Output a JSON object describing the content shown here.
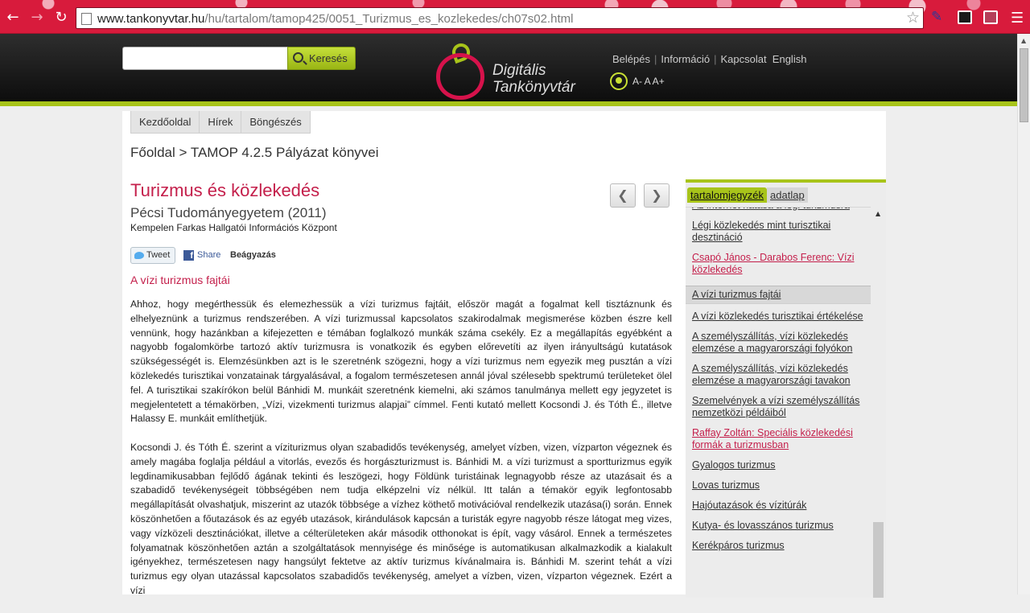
{
  "browser": {
    "url_host": "www.tankonyvtar.hu",
    "url_path": "/hu/tartalom/tamop425/0051_Turizmus_es_kozlekedes/ch07s02.html"
  },
  "header": {
    "search_button": "Keresés",
    "logo_line1": "Digitális",
    "logo_line2": "Tankönyvtár",
    "links": [
      "Belépés",
      "Információ",
      "Kapcsolat",
      "English"
    ],
    "font_sizes": "A- A A+"
  },
  "nav_tabs": [
    "Kezdőoldal",
    "Hírek",
    "Böngészés"
  ],
  "breadcrumb": "Főoldal > TAMOP 4.2.5 Pályázat könyvei",
  "book": {
    "title": "Turizmus és közlekedés",
    "subtitle": "Pécsi Tudományegyetem (2011)",
    "publisher": "Kempelen Farkas Hallgatói Információs Központ"
  },
  "social": {
    "tweet": "Tweet",
    "share": "Share",
    "embed": "Beágyazás"
  },
  "section_title": "A vízi turizmus fajtái",
  "paragraphs": [
    "Ahhoz, hogy megérthessük és elemezhessük a vízi turizmus fajtáit, először magát a fogalmat kell tisztáznunk és elhelyeznünk a turizmus rendszerében. A vízi turizmussal kapcsolatos szakirodalmak megismerése közben észre kell vennünk, hogy hazánkban a kifejezetten e témában foglalkozó munkák száma csekély. Ez a megállapítás egyébként a nagyobb fogalomkörbe tartozó aktív turizmusra is vonatkozik és egyben előrevetíti az ilyen irányultságú kutatások szükségességét is. Elemzésünkben azt is le szeretnénk szögezni, hogy a vízi turizmus nem egyezik meg pusztán a vízi közlekedés turisztikai vonzatainak tárgyalásával, a fogalom természetesen annál jóval szélesebb spektrumú területeket ölel fel. A turisztikai szakírókon belül Bánhidi M. munkáit szeretnénk kiemelni, aki számos tanulmánya mellett egy jegyzetet is megjelentetett a témakörben, „Vízi, vizekmenti turizmus alapjai” címmel. Fenti kutató mellett Kocsondi J. és Tóth É., illetve Halassy E. munkáit említhetjük.",
    "Kocsondi J. és Tóth É. szerint a víziturizmus olyan szabadidős tevékenység, amelyet vízben, vizen, vízparton végeznek és amely magába foglalja például a vitorlás, evezős és horgászturizmust is. Bánhidi M. a vízi turizmust a sportturizmus egyik legdinamikusabban fejlődő ágának tekinti és leszögezi, hogy Földünk turistáinak legnagyobb része az utazásait és a szabadidő tevékenységeit többségében nem tudja elképzelni víz nélkül. Itt talán a témakör egyik legfontosabb megállapítását olvashatjuk, miszerint az utazók többsége a vízhez köthető motivációval rendelkezik utazása(i) során. Ennek köszönhetően a főutazások és az egyéb utazások, kirándulások kapcsán a turisták egyre nagyobb része látogat meg vizes, vagy vízközeli desztinációkat, illetve a célterületeken akár második otthonokat is épít, vagy vásárol. Ennek a természetes folyamatnak köszönhetően aztán a szolgáltatások mennyisége és minősége is automatikusan alkalmazkodik a kialakult igényekhez, természetesen nagy hangsúlyt fektetve az aktív turizmus kívánalmaira is. Bánhidi M. szerint tehát a vízi turizmus egy olyan utazással kapcsolatos szabadidős tevékenység, amelyet a vízben, vizen, vízparton végeznek. Ezért a vízi"
  ],
  "sidebar": {
    "tab_toc": "tartalomjegyzék",
    "tab_data": "adatlap",
    "toc": [
      {
        "label": "Az internet hatása a légi turizmusra",
        "style": "normal"
      },
      {
        "label": "Légi közlekedés mint turisztikai desztináció",
        "style": "normal"
      },
      {
        "label": "Csapó János - Darabos Ferenc: Vízi közlekedés",
        "style": "red"
      },
      {
        "label": "A vízi turizmus fajtái",
        "style": "current"
      },
      {
        "label": "A vízi közlekedés turisztikai értékelése",
        "style": "normal"
      },
      {
        "label": "A személyszállítás, vízi közlekedés elemzése a magyarországi folyókon",
        "style": "normal"
      },
      {
        "label": "A személyszállítás, vízi közlekedés elemzése a magyarországi tavakon",
        "style": "normal"
      },
      {
        "label": "Szemelvények a vízi személyszállítás nemzetközi példáiból",
        "style": "normal"
      },
      {
        "label": "Raffay Zoltán: Speciális közlekedési formák a turizmusban",
        "style": "red"
      },
      {
        "label": "Gyalogos turizmus",
        "style": "normal"
      },
      {
        "label": "Lovas turizmus",
        "style": "normal"
      },
      {
        "label": "Hajóutazások és vízitúrák",
        "style": "normal"
      },
      {
        "label": "Kutya- és lovasszános turizmus",
        "style": "normal"
      },
      {
        "label": "Kerékpáros turizmus",
        "style": "normal"
      }
    ]
  }
}
